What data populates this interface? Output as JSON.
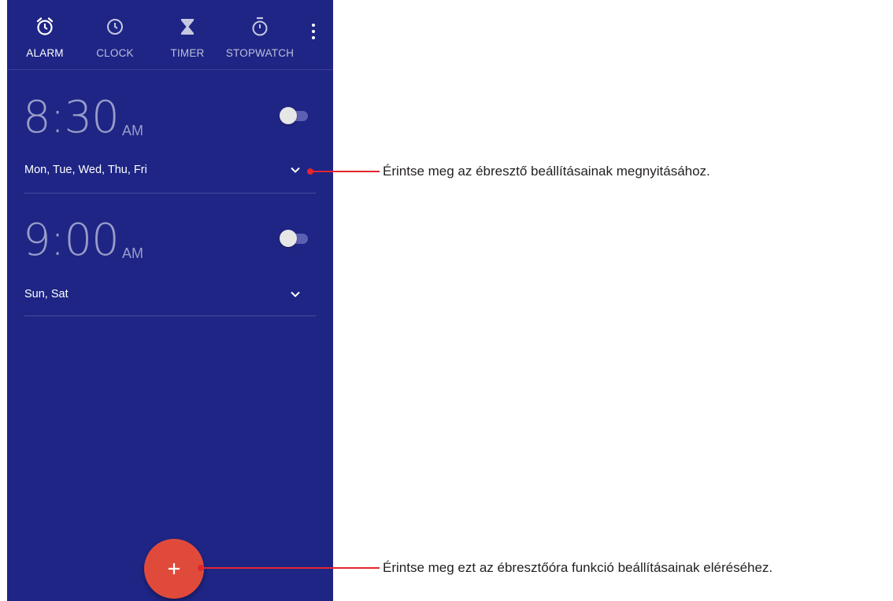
{
  "tabs": [
    {
      "label": "ALARM",
      "icon": "alarm-clock-icon",
      "active": true
    },
    {
      "label": "CLOCK",
      "icon": "clock-icon",
      "active": false
    },
    {
      "label": "TIMER",
      "icon": "hourglass-icon",
      "active": false
    },
    {
      "label": "STOPWATCH",
      "icon": "stopwatch-icon",
      "active": false
    }
  ],
  "alarms": [
    {
      "time": "8:30",
      "ampm": "AM",
      "days": "Mon, Tue, Wed, Thu, Fri",
      "enabled": false
    },
    {
      "time": "9:00",
      "ampm": "AM",
      "days": "Sun, Sat",
      "enabled": false
    }
  ],
  "callouts": {
    "expand": "Érintse meg az ébresztő beállításainak megnyitásához.",
    "add": "Érintse meg ezt az ébresztőóra funkció beállításainak eléréséhez."
  },
  "colors": {
    "background": "#1e2585",
    "fab": "#e04a3b",
    "callout": "#e3262d"
  }
}
